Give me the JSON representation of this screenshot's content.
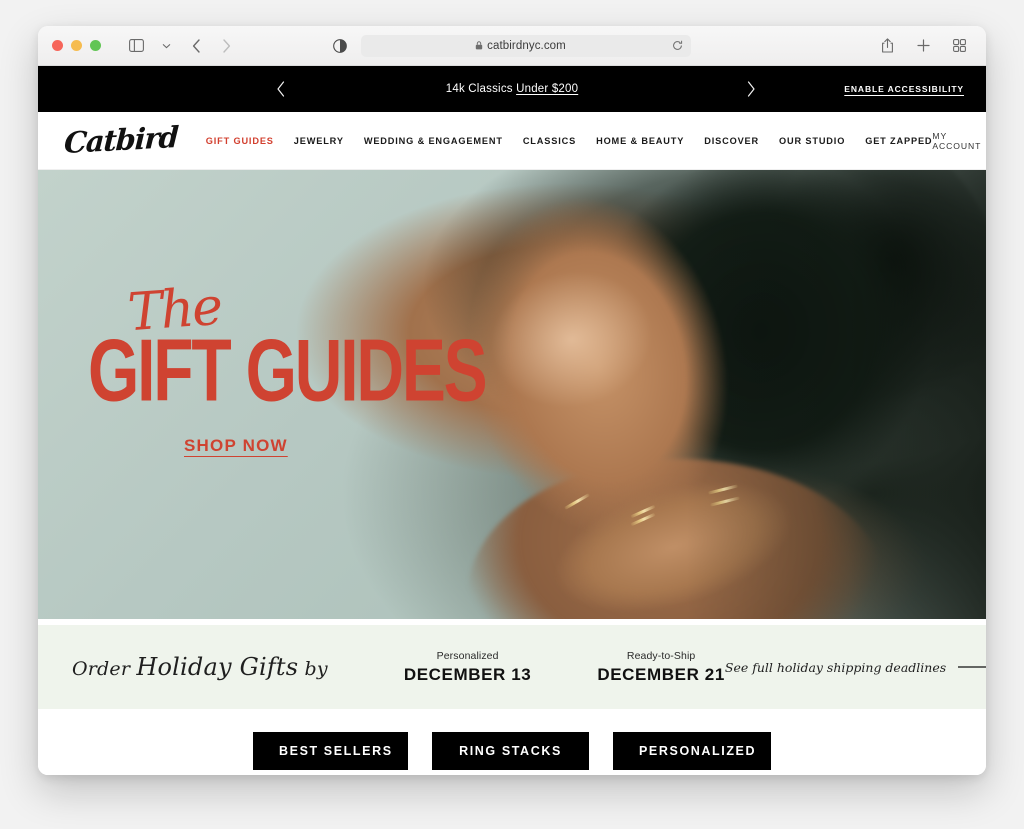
{
  "browser": {
    "address": "catbirdnyc.com",
    "icons": {
      "sidebar": "sidebar-toggle-icon",
      "chevron": "chevron-down-icon",
      "back": "back-arrow-icon",
      "forward": "forward-arrow-icon",
      "reader": "reader-mode-icon",
      "lock": "lock-icon",
      "reload": "reload-icon",
      "share": "share-icon",
      "newtab": "plus-icon",
      "tabs": "tab-overview-icon"
    },
    "traffic_lights": {
      "close": "#f6655a",
      "minimize": "#f6bc4f",
      "zoom": "#62c555"
    }
  },
  "announcement": {
    "message_prefix": "14k Classics ",
    "message_link": "Under $200",
    "prev_label": "‹",
    "next_label": "›",
    "accessibility": "ENABLE ACCESSIBILITY"
  },
  "header": {
    "logo": "Catbird",
    "nav": [
      {
        "label": "GIFT GUIDES",
        "accent": true
      },
      {
        "label": "JEWELRY",
        "accent": false
      },
      {
        "label": "WEDDING & ENGAGEMENT",
        "accent": false
      },
      {
        "label": "CLASSICS",
        "accent": false
      },
      {
        "label": "HOME & BEAUTY",
        "accent": false
      },
      {
        "label": "DISCOVER",
        "accent": false
      },
      {
        "label": "OUR STUDIO",
        "accent": false
      },
      {
        "label": "GET ZAPPED",
        "accent": false
      }
    ],
    "account_label": "MY ACCOUNT",
    "cart_icon": "shopping-bag-icon",
    "search_icon": "search-icon",
    "accent_color": "#d23f2e"
  },
  "hero": {
    "eyebrow": "The",
    "title": "GIFT GUIDES",
    "cta": "SHOP NOW",
    "text_color": "#cf4331",
    "background_color": "#b6c8c2"
  },
  "holiday_band": {
    "lead_in_1": "Order ",
    "lead_in_script": "Holiday Gifts",
    "lead_in_2": " by",
    "deadlines": [
      {
        "label": "Personalized",
        "date": "DECEMBER 13"
      },
      {
        "label": "Ready-to-Ship",
        "date": "DECEMBER 21"
      }
    ],
    "link_text": "See full holiday shipping deadlines",
    "arrow_icon": "long-right-arrow-icon",
    "background_color": "#eff4ec"
  },
  "cta_buttons": [
    {
      "label": "BEST SELLERS"
    },
    {
      "label": "RING STACKS"
    },
    {
      "label": "PERSONALIZED"
    }
  ]
}
